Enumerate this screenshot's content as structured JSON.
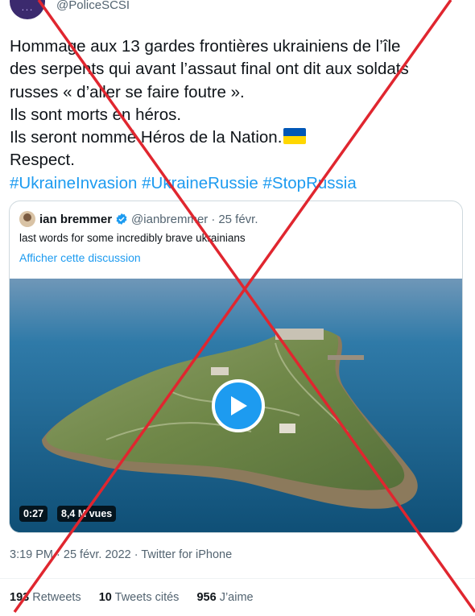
{
  "author": {
    "handle": "@PoliceSCSI"
  },
  "tweet": {
    "lines": [
      "Hommage aux 13 gardes frontières ukrainiens de l’île",
      "des serpents qui avant l’assaut final ont dit aux soldats",
      "russes « d’aller se faire foutre ».",
      "Ils sont morts en héros.",
      "Ils seront nommé Héros de la Nation.",
      "Respect."
    ],
    "hashtags": [
      "#UkraineInvasion",
      "#UkraineRussie",
      "#StopRussia"
    ]
  },
  "quote": {
    "name": "ian bremmer",
    "handle": "@ianbremmer",
    "separator": "·",
    "date": "25 févr.",
    "text": "last words for some incredibly brave ukrainians",
    "link": "Afficher cette discussion",
    "video": {
      "duration": "0:27",
      "views": "8,4 M vues"
    }
  },
  "meta": "3:19 PM · 25 févr. 2022 · Twitter for iPhone",
  "stats": {
    "retweets": {
      "count": "193",
      "label": "Retweets"
    },
    "quotes": {
      "count": "10",
      "label": "Tweets cités"
    },
    "likes": {
      "count": "956",
      "label": "J’aime"
    }
  },
  "overlay": {
    "color": "#e0262f",
    "icon": "red-cross-icon"
  }
}
